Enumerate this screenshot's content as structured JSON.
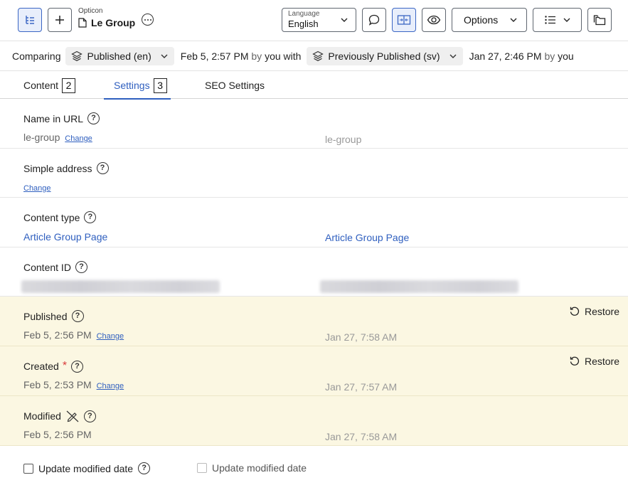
{
  "toolbar": {
    "brand": "Opticon",
    "page_name": "Le Group",
    "language_caption": "Language",
    "language_value": "English",
    "options_label": "Options"
  },
  "compare": {
    "label": "Comparing",
    "left_version": "Published (en)",
    "left_meta_date": "Feb 5, 2:57 PM",
    "left_meta_by": "by",
    "left_meta_user": "you with",
    "right_version": "Previously Published (sv)",
    "right_meta_date": "Jan 27, 2:46 PM",
    "right_meta_by": "by",
    "right_meta_user": "you"
  },
  "tabs": [
    {
      "label": "Content",
      "count": "2"
    },
    {
      "label": "Settings",
      "count": "3"
    },
    {
      "label": "SEO Settings"
    }
  ],
  "fields": {
    "name_in_url": {
      "label": "Name in URL",
      "left": "le-group",
      "change": "Change",
      "right": "le-group"
    },
    "simple_address": {
      "label": "Simple address",
      "change": "Change"
    },
    "content_type": {
      "label": "Content type",
      "left": "Article Group Page",
      "right": "Article Group Page"
    },
    "content_id": {
      "label": "Content ID"
    },
    "published": {
      "label": "Published",
      "left": "Feb 5, 2:56 PM",
      "change": "Change",
      "right": "Jan 27, 7:58 AM",
      "restore": "Restore"
    },
    "created": {
      "label": "Created",
      "required_mark": "*",
      "left": "Feb 5, 2:53 PM",
      "change": "Change",
      "right": "Jan 27, 7:57 AM",
      "restore": "Restore"
    },
    "modified": {
      "label": "Modified",
      "left": "Feb 5, 2:56 PM",
      "right": "Jan 27, 7:58 AM"
    }
  },
  "footer": {
    "left_checkbox": "Update modified date",
    "right_checkbox": "Update modified date"
  },
  "colors": {
    "accent": "#2f5fbf",
    "highlight_row": "#fbf7e2"
  }
}
